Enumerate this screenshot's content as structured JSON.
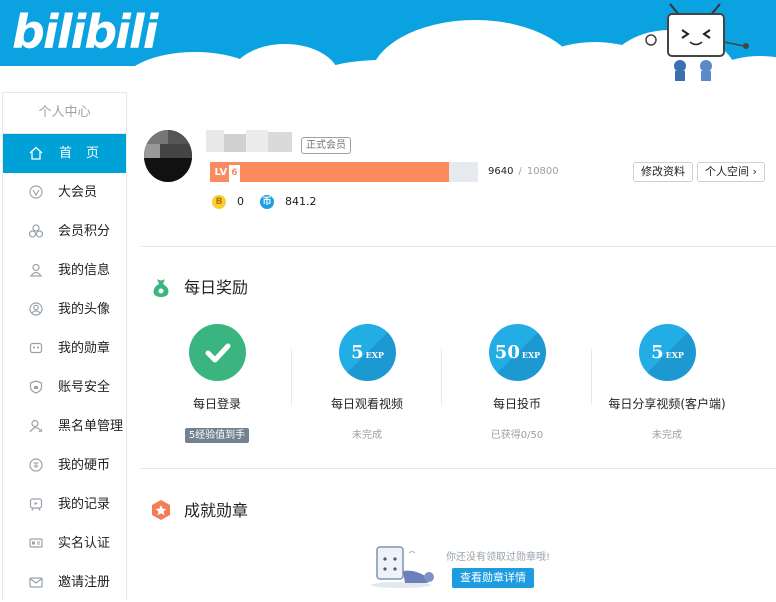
{
  "header": {
    "logo_text": "bilibili"
  },
  "sidebar": {
    "title": "个人中心",
    "items": [
      {
        "label": "首页",
        "icon": "home-icon",
        "active": true
      },
      {
        "label": "大会员",
        "icon": "vip-icon"
      },
      {
        "label": "会员积分",
        "icon": "points-icon"
      },
      {
        "label": "我的信息",
        "icon": "user-info-icon"
      },
      {
        "label": "我的头像",
        "icon": "avatar-icon"
      },
      {
        "label": "我的勋章",
        "icon": "medal-icon"
      },
      {
        "label": "账号安全",
        "icon": "shield-icon"
      },
      {
        "label": "黑名单管理",
        "icon": "blacklist-icon"
      },
      {
        "label": "我的硬币",
        "icon": "coin-icon"
      },
      {
        "label": "我的记录",
        "icon": "record-icon"
      },
      {
        "label": "实名认证",
        "icon": "id-card-icon"
      },
      {
        "label": "邀请注册",
        "icon": "invite-icon"
      }
    ]
  },
  "profile": {
    "vip_badge": "正式会员",
    "level_label": "LV",
    "level_value": "6",
    "exp_current": "9640",
    "exp_separator": "/",
    "exp_max": "10800",
    "exp_progress": 0.8926,
    "edit_button": "修改资料",
    "space_button": "个人空间 ›",
    "bcoin_symbol": "B",
    "bcoin_value": "0",
    "coin_symbol": "币",
    "coin_value": "841.2"
  },
  "daily": {
    "title": "每日奖励",
    "tasks": [
      {
        "name": "每日登录",
        "status": "5经验值到手",
        "done": true
      },
      {
        "name": "每日观看视频",
        "exp": "5",
        "unit": "EXP",
        "status": "未完成"
      },
      {
        "name": "每日投币",
        "exp": "50",
        "unit": "EXP",
        "status": "已获得0/50"
      },
      {
        "name": "每日分享视频(客户端)",
        "exp": "5",
        "unit": "EXP",
        "status": "未完成"
      }
    ]
  },
  "achievements": {
    "title": "成就勋章",
    "empty_text": "你还没有领取过勋章哦!",
    "button": "查看勋章详情"
  },
  "colors": {
    "brand_blue": "#00a1d6",
    "banner": "#0aa2e1",
    "progress": "#fc8a5f",
    "done_green": "#3bb57f"
  }
}
